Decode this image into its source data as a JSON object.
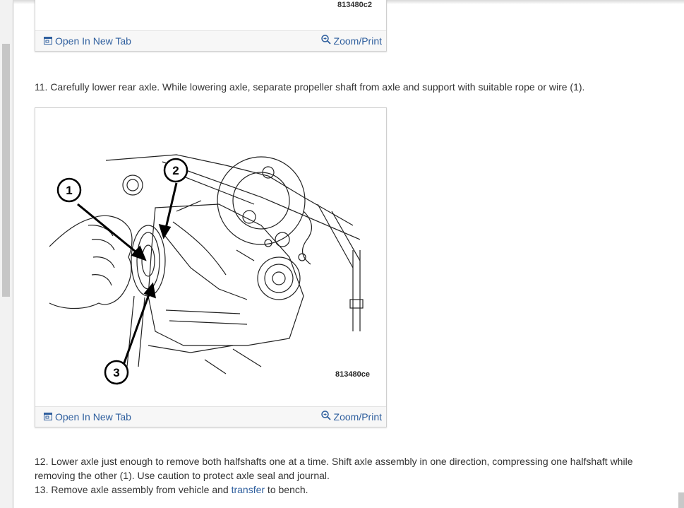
{
  "figures": [
    {
      "code": "813480c2",
      "open_tab_label": "Open In New Tab",
      "zoom_label": "Zoom/Print"
    },
    {
      "code": "813480ce",
      "open_tab_label": "Open In New Tab",
      "zoom_label": "Zoom/Print",
      "callouts": [
        "1",
        "2",
        "3"
      ]
    }
  ],
  "steps": {
    "s11": "11. Carefully lower rear axle. While lowering axle, separate propeller shaft from axle and support with suitable rope or wire (1).",
    "s12": "12. Lower axle just enough to remove both halfshafts one at a time. Shift axle assembly in one direction, compressing one halfshaft while removing the other (1). Use caution to protect axle seal and journal.",
    "s13_pre": "13. Remove axle assembly from vehicle and ",
    "s13_link": "transfer",
    "s13_post": " to bench."
  },
  "icons": {
    "open_tab": "open-in-new-tab-icon",
    "zoom": "zoom-magnifier-icon"
  },
  "colors": {
    "link": "#2f5f9e",
    "text": "#333333"
  }
}
